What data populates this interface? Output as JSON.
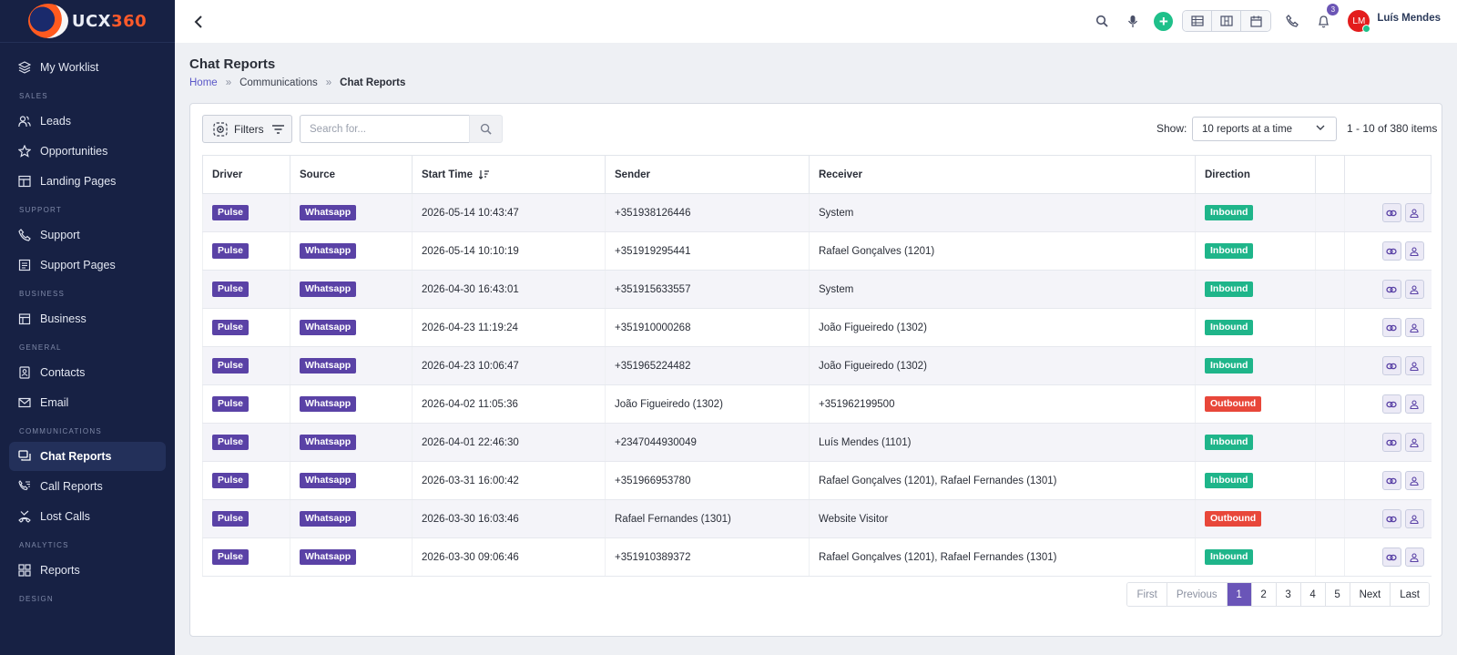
{
  "app": {
    "logo_text_main": "UCX",
    "logo_text_accent": "360"
  },
  "sidebar": {
    "items": [
      {
        "type": "item",
        "label": "My Worklist",
        "icon": "layers-icon",
        "active": false
      },
      {
        "type": "section",
        "label": "SALES"
      },
      {
        "type": "item",
        "label": "Leads",
        "icon": "users-icon",
        "active": false
      },
      {
        "type": "item",
        "label": "Opportunities",
        "icon": "star-icon",
        "active": false
      },
      {
        "type": "item",
        "label": "Landing Pages",
        "icon": "layout-icon",
        "active": false
      },
      {
        "type": "section",
        "label": "SUPPORT"
      },
      {
        "type": "item",
        "label": "Support",
        "icon": "phone-icon",
        "active": false
      },
      {
        "type": "item",
        "label": "Support Pages",
        "icon": "document-icon",
        "active": false
      },
      {
        "type": "section",
        "label": "BUSINESS"
      },
      {
        "type": "item",
        "label": "Business",
        "icon": "building-icon",
        "active": false
      },
      {
        "type": "section",
        "label": "GENERAL"
      },
      {
        "type": "item",
        "label": "Contacts",
        "icon": "contact-book-icon",
        "active": false
      },
      {
        "type": "item",
        "label": "Email",
        "icon": "mail-icon",
        "active": false
      },
      {
        "type": "section",
        "label": "COMMUNICATIONS"
      },
      {
        "type": "item",
        "label": "Chat Reports",
        "icon": "chat-icon",
        "active": true
      },
      {
        "type": "item",
        "label": "Call Reports",
        "icon": "call-list-icon",
        "active": false
      },
      {
        "type": "item",
        "label": "Lost Calls",
        "icon": "missed-call-icon",
        "active": false
      },
      {
        "type": "section",
        "label": "ANALYTICS"
      },
      {
        "type": "item",
        "label": "Reports",
        "icon": "dashboard-icon",
        "active": false
      },
      {
        "type": "section",
        "label": "DESIGN"
      }
    ]
  },
  "topbar": {
    "notification_count": "3",
    "avatar_initials": "LM",
    "user_name": "Luís Mendes"
  },
  "page": {
    "title": "Chat Reports",
    "breadcrumb": {
      "home": "Home",
      "separator": "»",
      "parent": "Communications",
      "current": "Chat Reports"
    }
  },
  "toolbar": {
    "filters_label": "Filters",
    "search_placeholder": "Search for...",
    "show_label": "Show:",
    "show_value": "10 reports at a time",
    "range_text": "1 - 10 of 380 items"
  },
  "table": {
    "columns": [
      "Driver",
      "Source",
      "Start Time",
      "Sender",
      "Receiver",
      "Direction",
      "",
      ""
    ],
    "rows": [
      {
        "driver": "Pulse",
        "source": "Whatsapp",
        "start_time": "2026-05-14 10:43:47",
        "sender": "+351938126446",
        "receiver": "System",
        "direction": "Inbound"
      },
      {
        "driver": "Pulse",
        "source": "Whatsapp",
        "start_time": "2026-05-14 10:10:19",
        "sender": "+351919295441",
        "receiver": "Rafael Gonçalves (1201)",
        "direction": "Inbound"
      },
      {
        "driver": "Pulse",
        "source": "Whatsapp",
        "start_time": "2026-04-30 16:43:01",
        "sender": "+351915633557",
        "receiver": "System",
        "direction": "Inbound"
      },
      {
        "driver": "Pulse",
        "source": "Whatsapp",
        "start_time": "2026-04-23 11:19:24",
        "sender": "+351910000268",
        "receiver": "João Figueiredo (1302)",
        "direction": "Inbound"
      },
      {
        "driver": "Pulse",
        "source": "Whatsapp",
        "start_time": "2026-04-23 10:06:47",
        "sender": "+351965224482",
        "receiver": "João Figueiredo (1302)",
        "direction": "Inbound"
      },
      {
        "driver": "Pulse",
        "source": "Whatsapp",
        "start_time": "2026-04-02 11:05:36",
        "sender": "João Figueiredo (1302)",
        "receiver": "+351962199500",
        "direction": "Outbound"
      },
      {
        "driver": "Pulse",
        "source": "Whatsapp",
        "start_time": "2026-04-01 22:46:30",
        "sender": "+2347044930049",
        "receiver": "Luís Mendes (1101)",
        "direction": "Inbound"
      },
      {
        "driver": "Pulse",
        "source": "Whatsapp",
        "start_time": "2026-03-31 16:00:42",
        "sender": "+351966953780",
        "receiver": "Rafael Gonçalves (1201), Rafael Fernandes (1301)",
        "direction": "Inbound"
      },
      {
        "driver": "Pulse",
        "source": "Whatsapp",
        "start_time": "2026-03-30 16:03:46",
        "sender": "Rafael Fernandes (1301)",
        "receiver": "Website Visitor",
        "direction": "Outbound"
      },
      {
        "driver": "Pulse",
        "source": "Whatsapp",
        "start_time": "2026-03-30 09:06:46",
        "sender": "+351910389372",
        "receiver": "Rafael Gonçalves (1201), Rafael Fernandes (1301)",
        "direction": "Inbound"
      }
    ]
  },
  "pagination": {
    "first": "First",
    "previous": "Previous",
    "pages": [
      "1",
      "2",
      "3",
      "4",
      "5"
    ],
    "current_page": "1",
    "next": "Next",
    "last": "Last"
  },
  "colors": {
    "sidebar_bg": "#172144",
    "accent_purple": "#5a42a6",
    "inbound_green": "#1fb58a",
    "outbound_red": "#e8473a",
    "brand_orange": "#ff5a2a"
  }
}
